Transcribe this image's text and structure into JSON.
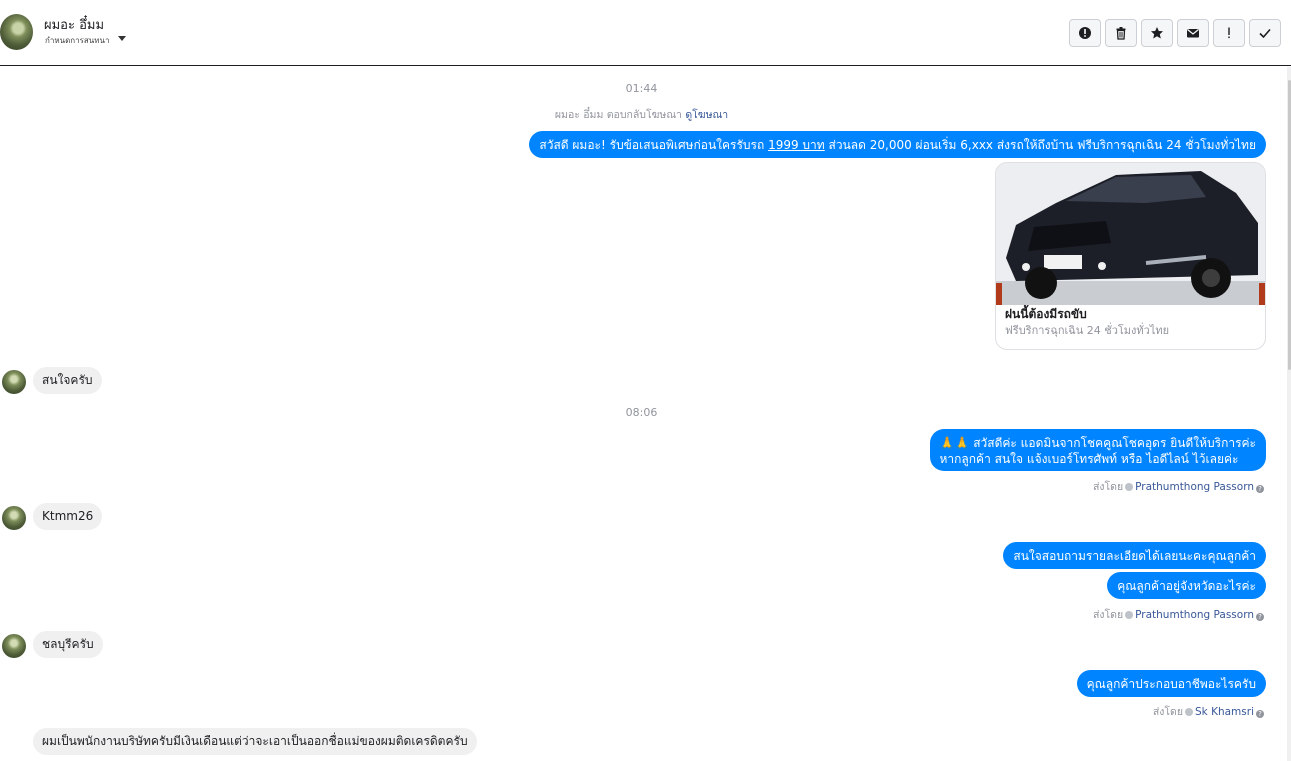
{
  "header": {
    "name": "ผมอะ อึ๋มม",
    "subtitle": "กำหนดการสนทนา",
    "actions": [
      {
        "name": "report-icon",
        "label": "!"
      },
      {
        "name": "trash-icon",
        "label": ""
      },
      {
        "name": "star-icon",
        "label": ""
      },
      {
        "name": "mail-icon",
        "label": ""
      },
      {
        "name": "exclamation-icon",
        "label": "!"
      },
      {
        "name": "check-icon",
        "label": ""
      }
    ]
  },
  "conversation": {
    "time_1": "01:44",
    "ad_reply_text": "ผมอะ อึ๋มม ตอบกลับโฆษณา",
    "ad_reply_link": "ดูโฆษณา",
    "msg_out_1": {
      "part_a": "สวัสดี ผมอะ! รับข้อเสนอพิเศษก่อนใครรับรถ",
      "part_b": "1999 บาท",
      "part_c": "ส่วนลด 20,000  ผ่อนเริ่ม 6,xxx ส่งรถให้ถึงบ้าน ฟรีบริการฉุกเฉิน 24 ชั่วโมงทั่วไทย"
    },
    "card": {
      "title": "ฝนนี้ต้องมีรถขับ",
      "subtitle": "ฟรีบริการฉุกเฉิน 24 ชั่วโมงทั่วไทย"
    },
    "msg_in_1": "สนใจครับ",
    "time_2": "08:06",
    "msg_out_2_line1": "🙏🙏 สวัสดีค่ะ แอดมินจากโชคคูณโชคอุดร ยินดีให้บริการค่ะ",
    "msg_out_2_line2": "หากลูกค้า สนใจ แจ้งเบอร์โทรศัพท์ หรือ ไอดีไลน์  ไว้เลยค่ะ",
    "sent_by_label": "ส่งโดย",
    "agent_1": "Prathumthong Passorn",
    "msg_in_2": "Ktmm26",
    "msg_out_3": "สนใจสอบถามรายละเอียดได้เลยนะคะคุณลูกค้า",
    "msg_out_4": "คุณลูกค้าอยู่จังหวัดอะไรค่ะ",
    "agent_2": "Prathumthong Passorn",
    "msg_in_3": "ชลบุรีครับ",
    "msg_out_5": "คุณลูกค้าประกอบอาชีพอะไรครับ",
    "agent_3": "Sk Khamsri",
    "msg_in_4": "ผมเป็นพนักงานบริษัทครับมีเงินเดือนแต่ว่าจะเอาเป็นออกชื่อแม่ของผมติดเครดิตครับ"
  },
  "colors": {
    "outgoing_bubble": "#0084ff",
    "incoming_bubble": "#f1f0f0",
    "link": "#385898",
    "muted_text": "#90949c"
  }
}
